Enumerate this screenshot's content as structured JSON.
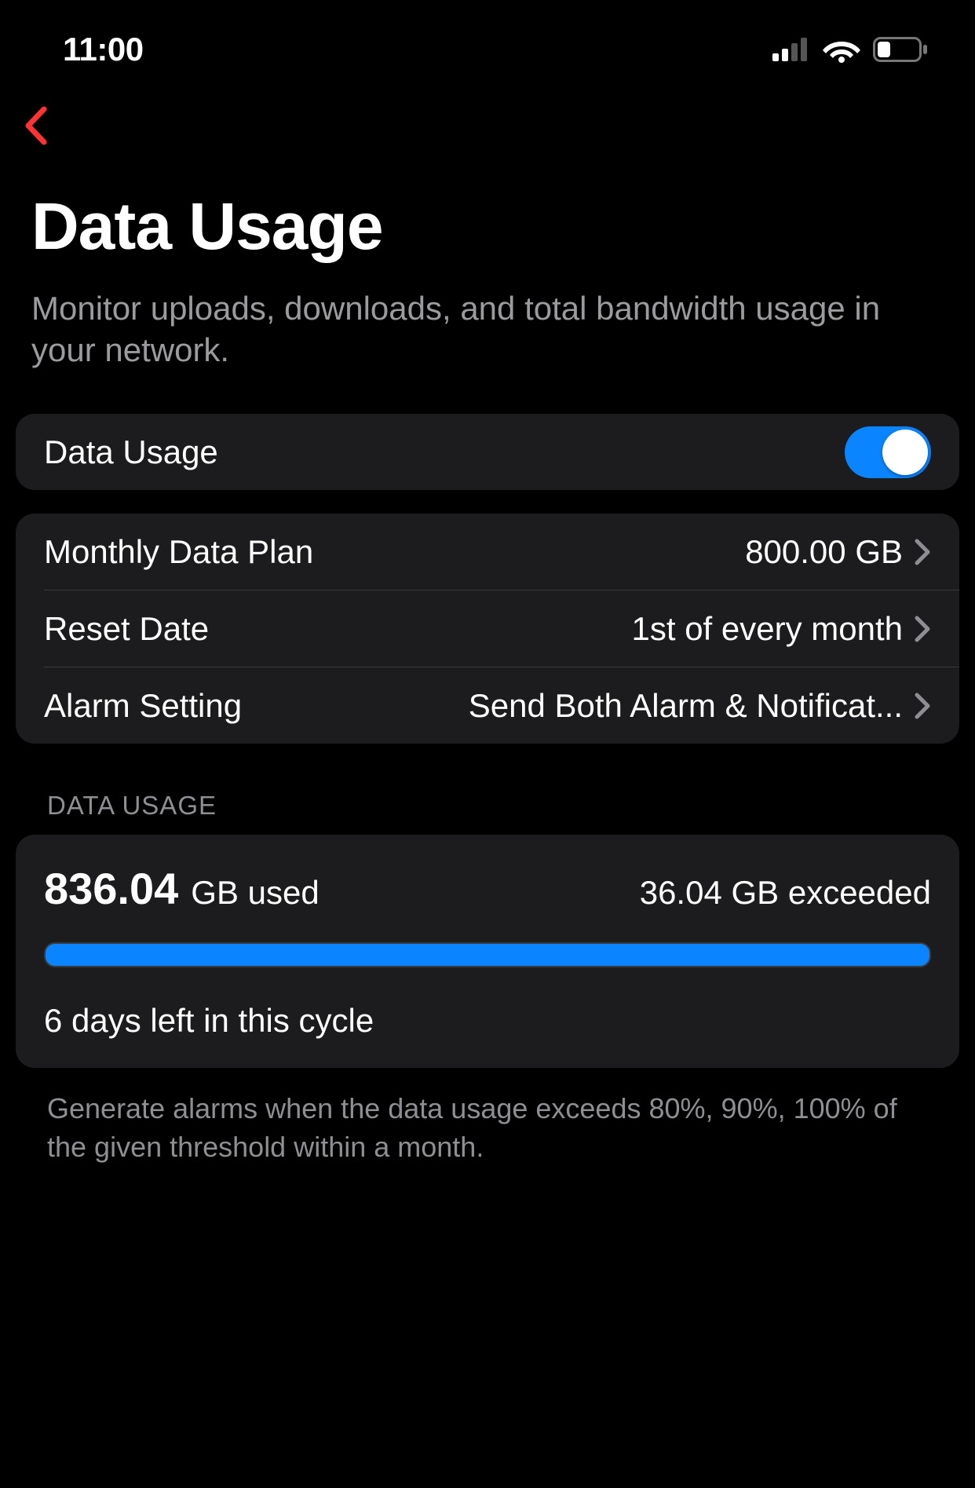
{
  "status_bar": {
    "time": "11:00"
  },
  "header": {
    "title": "Data Usage",
    "subtitle": "Monitor uploads, downloads, and total bandwidth usage in your network."
  },
  "toggle_card": {
    "label": "Data Usage",
    "enabled": true
  },
  "settings": {
    "monthly_plan": {
      "label": "Monthly Data Plan",
      "value": "800.00 GB"
    },
    "reset_date": {
      "label": "Reset Date",
      "value": "1st of every month"
    },
    "alarm_setting": {
      "label": "Alarm Setting",
      "value": "Send Both Alarm & Notificat..."
    }
  },
  "usage_section": {
    "header": "DATA USAGE",
    "amount": "836.04",
    "unit": "GB used",
    "exceeded": "36.04 GB exceeded",
    "cycle": "6 days left in this cycle"
  },
  "footer": "Generate alarms when the data usage exceeds 80%, 90%, 100% of the given threshold within a month."
}
